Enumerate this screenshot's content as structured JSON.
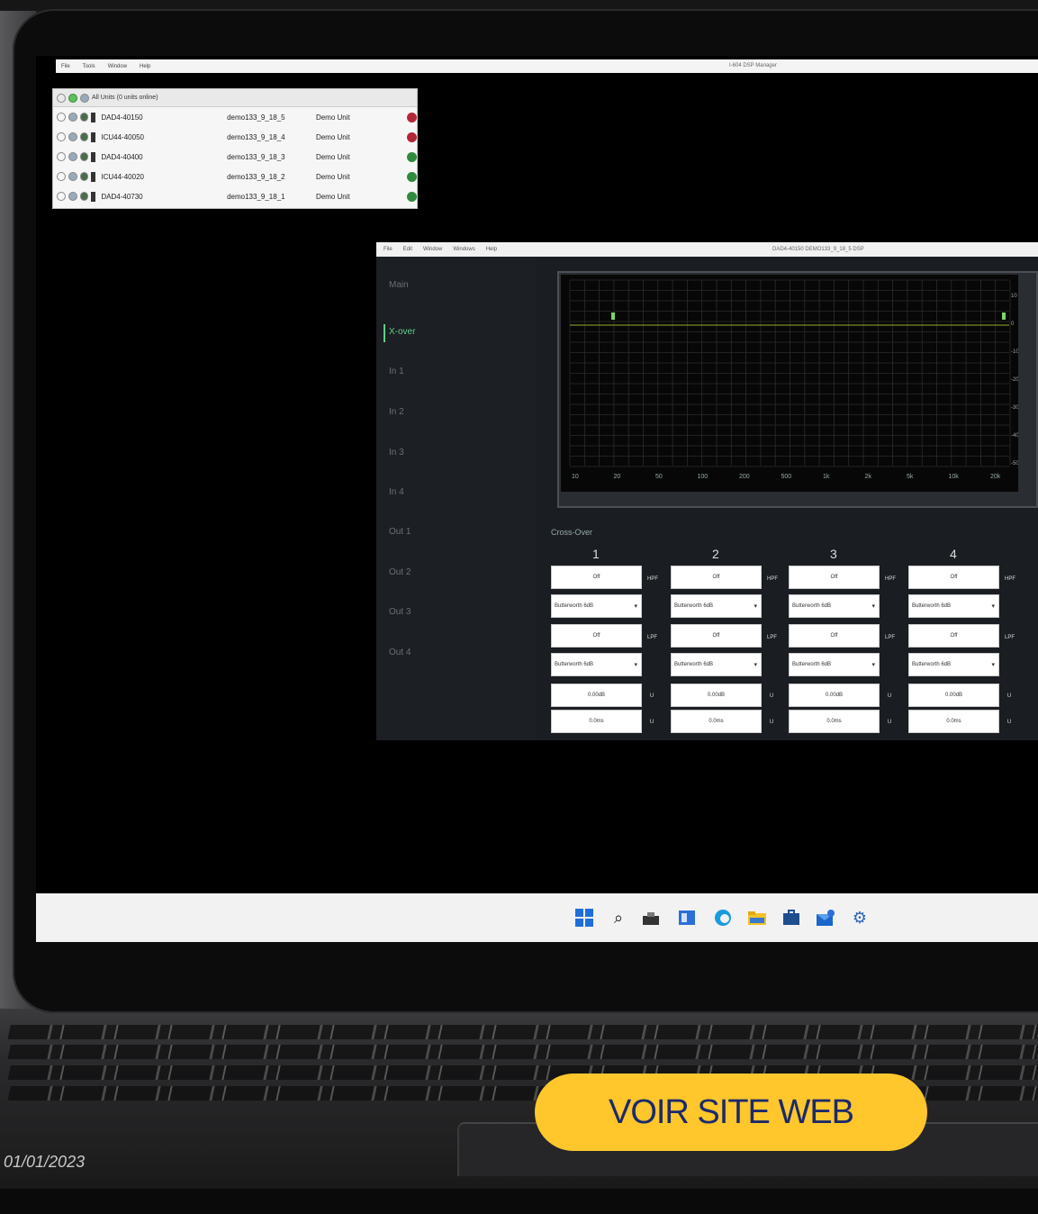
{
  "main_window": {
    "menu": [
      "File",
      "Tools",
      "Window",
      "Help"
    ],
    "title": "I-604 DSP Manager"
  },
  "units_panel": {
    "header": "All Units (0 units online)",
    "rows": [
      {
        "name": "DAD4-40150",
        "ip": "demo133_9_18_5",
        "type": "Demo Unit",
        "status_color": "#b3263a"
      },
      {
        "name": "ICU44-40050",
        "ip": "demo133_9_18_4",
        "type": "Demo Unit",
        "status_color": "#b3263a"
      },
      {
        "name": "DAD4-40400",
        "ip": "demo133_9_18_3",
        "type": "Demo Unit",
        "status_color": "#2e8a3c"
      },
      {
        "name": "ICU44-40020",
        "ip": "demo133_9_18_2",
        "type": "Demo Unit",
        "status_color": "#2e8a3c"
      },
      {
        "name": "DAD4-40730",
        "ip": "demo133_9_18_1",
        "type": "Demo Unit",
        "status_color": "#2e8a3c"
      }
    ]
  },
  "dsp_window": {
    "menu": [
      "File",
      "Edit",
      "Window",
      "Windows",
      "Help"
    ],
    "title": "DAD4-40150 DEMO133_9_18_5 DSP",
    "sidebar": [
      "Main",
      "X-over",
      "In 1",
      "In 2",
      "In 3",
      "In 4",
      "Out 1",
      "Out 2",
      "Out 3",
      "Out 4"
    ],
    "active_item": "X-over",
    "graph": {
      "x_ticks": [
        "10",
        "20",
        "50",
        "100",
        "200",
        "500",
        "1k",
        "2k",
        "5k",
        "10k",
        "20k"
      ],
      "y_ticks": [
        "10",
        "0",
        "-10",
        "-20",
        "-30",
        "-40",
        "-50"
      ]
    },
    "crossover_label": "Cross-Over",
    "columns": [
      {
        "num": "1",
        "hpf_value": "Off",
        "hpf_type": "Butterworth 6dB",
        "lpf_value": "Off",
        "lpf_type": "Butterworth 6dB",
        "gain": "0.00dB",
        "delay": "0.0ms"
      },
      {
        "num": "2",
        "hpf_value": "Off",
        "hpf_type": "Butterworth 6dB",
        "lpf_value": "Off",
        "lpf_type": "Butterworth 6dB",
        "gain": "0.00dB",
        "delay": "0.0ms"
      },
      {
        "num": "3",
        "hpf_value": "Off",
        "hpf_type": "Butterworth 6dB",
        "lpf_value": "Off",
        "lpf_type": "Butterworth 6dB",
        "gain": "0.00dB",
        "delay": "0.0ms"
      },
      {
        "num": "4",
        "hpf_value": "Off",
        "hpf_type": "Butterworth 6dB",
        "lpf_value": "Off",
        "lpf_type": "Butterworth 6dB",
        "gain": "0.00dB",
        "delay": "0.0ms"
      }
    ],
    "hpf_label": "HPF",
    "lpf_label": "LPF",
    "gain_unit_label": "U",
    "delay_unit_label": "U"
  },
  "taskbar": {
    "icons": [
      "windows-start-icon",
      "search-icon",
      "task-view-icon",
      "widgets-icon",
      "edge-browser-icon",
      "file-explorer-icon",
      "store-icon",
      "mail-icon",
      "settings-icon"
    ]
  },
  "cta": {
    "label": "VOIR SITE WEB",
    "color": "#ffc72c",
    "text_color": "#1c2a6b"
  },
  "date": "01/01/2023"
}
